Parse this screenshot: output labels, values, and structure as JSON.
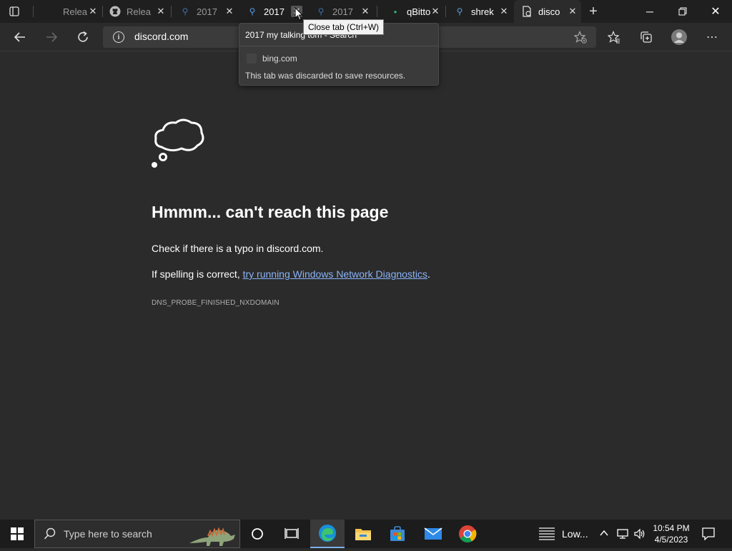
{
  "browser": {
    "tabs": [
      {
        "title": "Relea",
        "icon": "document-icon",
        "state": "normal"
      },
      {
        "title": "Relea",
        "icon": "github-icon",
        "state": "normal"
      },
      {
        "title": "2017",
        "icon": "search-icon",
        "state": "normal"
      },
      {
        "title": "2017",
        "icon": "search-icon",
        "state": "hover"
      },
      {
        "title": "2017",
        "icon": "search-icon",
        "state": "normal"
      },
      {
        "title": "qBitto",
        "icon": "loading-icon",
        "state": "normal"
      },
      {
        "title": "shrek",
        "icon": "search-icon",
        "state": "normal"
      },
      {
        "title": "disco",
        "icon": "page-error-icon",
        "state": "active"
      }
    ],
    "address": {
      "url": "discord.com"
    },
    "hover_card": {
      "title": "2017 my talking tom - Search",
      "domain": "bing.com",
      "note": "This tab was discarded to save resources."
    },
    "tooltip": "Close tab (Ctrl+W)"
  },
  "error_page": {
    "title": "Hmmm... can't reach this page",
    "line1": "Check if there is a typo in discord.com.",
    "line2_prefix": "If spelling is correct, ",
    "line2_link": "try running Windows Network Diagnostics",
    "line2_suffix": ".",
    "code": "DNS_PROBE_FINISHED_NXDOMAIN"
  },
  "taskbar": {
    "search_placeholder": "Type here to search",
    "weather": "Low...",
    "time": "10:54 PM",
    "date": "4/5/2023"
  },
  "colors": {
    "page_bg": "#2b2b2b",
    "tabstrip_bg": "#1f1f1f",
    "link": "#8ab4f8",
    "taskbar_bg": "#1c1c1c"
  }
}
